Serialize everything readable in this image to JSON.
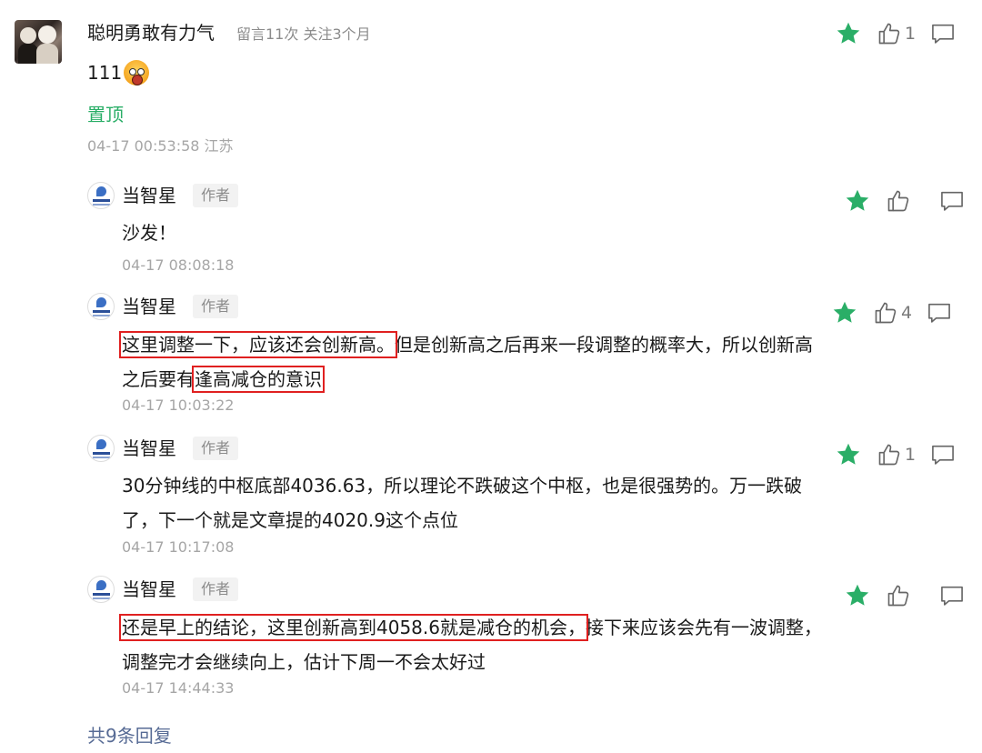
{
  "main_comment": {
    "nickname": "聪明勇敢有力气",
    "meta": "留言11次 关注3个月",
    "text": "111",
    "pinned_label": "置顶",
    "time": "04-17 00:53:58 江苏",
    "likes": "1"
  },
  "replies": [
    {
      "name": "当智星",
      "badge": "作者",
      "text_parts": [
        "沙发！",
        "",
        "",
        ""
      ],
      "time": "04-17 08:08:18",
      "likes": ""
    },
    {
      "name": "当智星",
      "badge": "作者",
      "text_parts": [
        "这里调整一下，应该还会创新高。",
        "但是创新高之后再来一段调整的概率大，所以创新高之后要有",
        "逢高减仓的意识",
        ""
      ],
      "time": "04-17 10:03:22",
      "likes": "4"
    },
    {
      "name": "当智星",
      "badge": "作者",
      "text_parts": [
        "30分钟线的中枢底部4036.63，所以理论不跌破这个中枢，也是很强势的。万一跌破了，下一个就是文章提的4020.9这个点位",
        "",
        "",
        ""
      ],
      "time": "04-17 10:17:08",
      "likes": "1"
    },
    {
      "name": "当智星",
      "badge": "作者",
      "text_parts": [
        "还是早上的结论，这里创新高到4058.6就是减仓的机会，",
        "接下来应该会先有一波调整，调整完才会继续向上，估计下周一不会太好过",
        "",
        ""
      ],
      "time": "04-17 14:44:33",
      "likes": ""
    }
  ],
  "total_replies": "共9条回复",
  "colors": {
    "star": "#2aae67",
    "pin": "#2aae67",
    "link": "#576b95",
    "highlight_box": "#e02020"
  },
  "icons": [
    "star-icon",
    "thumbs-up-icon",
    "reply-bubble-icon"
  ]
}
